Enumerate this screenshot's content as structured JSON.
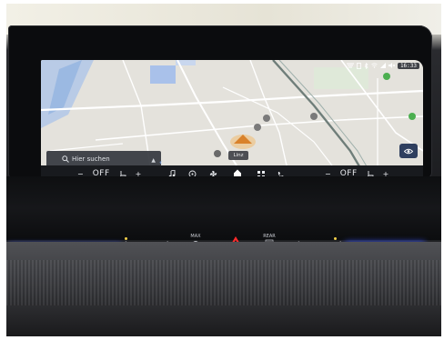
{
  "status_bar": {
    "time": "16:33",
    "icons": [
      "no-data-icon",
      "battery-icon",
      "bluetooth-icon",
      "wifi-icon",
      "signal-icon",
      "mute-icon"
    ]
  },
  "map": {
    "search_placeholder": "Hier suchen",
    "place_label": "Linz",
    "layer_button_icon": "eye-icon"
  },
  "climate": {
    "left": {
      "minus": "−",
      "state": "OFF",
      "plus": "+",
      "icon": "seat-heat-icon"
    },
    "right": {
      "minus": "−",
      "state": "OFF",
      "plus": "+",
      "icon": "seat-heat-icon"
    }
  },
  "dock": {
    "items": [
      "music-note-icon",
      "media-icon",
      "fan-icon",
      "home-icon",
      "apps-grid-icon",
      "phone-icon"
    ]
  },
  "hardware": {
    "max_label": "MAX",
    "rear_label": "REAR",
    "left_scale": {
      "min": "0",
      "max": "1"
    },
    "right_scale": {
      "min": "0",
      "max": "1"
    }
  },
  "colors": {
    "accent_blue": "#3c66ff",
    "hazard_red": "#ff2a2a",
    "heat_red": "#ff3b3b"
  }
}
